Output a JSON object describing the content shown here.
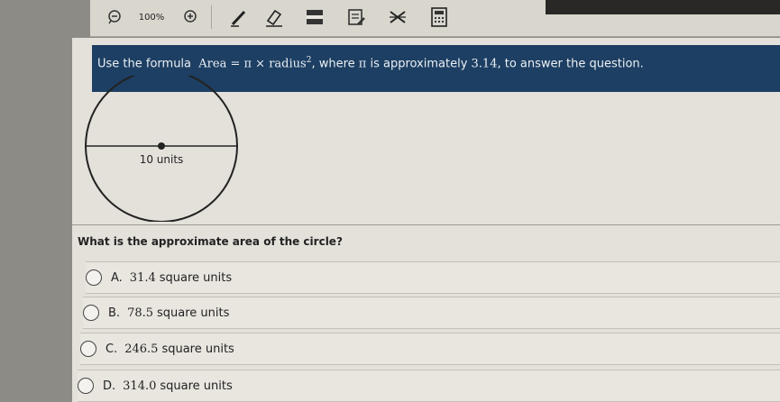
{
  "toolbar": {
    "zoom_out_icon": "zoom-out-icon",
    "zoom_label": "100%",
    "zoom_in_icon": "zoom-in-icon",
    "tools": [
      "pencil-icon",
      "eraser-icon",
      "line-reader-icon",
      "highlighter-icon",
      "answer-eliminator-icon",
      "calculator-icon"
    ]
  },
  "banner": {
    "prefix": "Use the formula",
    "formula_area": "Area = ",
    "formula_pi": "π",
    "formula_times": " × ",
    "formula_radius": "radius",
    "formula_exp": "2",
    "suffix_1": ", where ",
    "suffix_pi": "π",
    "suffix_2": " is approximately ",
    "pi_value": "3.14",
    "suffix_3": ", to answer the question."
  },
  "figure": {
    "diameter_label": "10 units"
  },
  "question": {
    "text": "What is the approximate area of the circle?"
  },
  "choices": [
    {
      "letter": "A.",
      "value": "31.4",
      "unit": "square units"
    },
    {
      "letter": "B.",
      "value": "78.5",
      "unit": "square units"
    },
    {
      "letter": "C.",
      "value": "246.5",
      "unit": "square units"
    },
    {
      "letter": "D.",
      "value": "314.0",
      "unit": "square units"
    }
  ],
  "colors": {
    "banner": "#1d3f63",
    "panel": "#e4e1db",
    "toolbar": "#d9d6ce"
  }
}
